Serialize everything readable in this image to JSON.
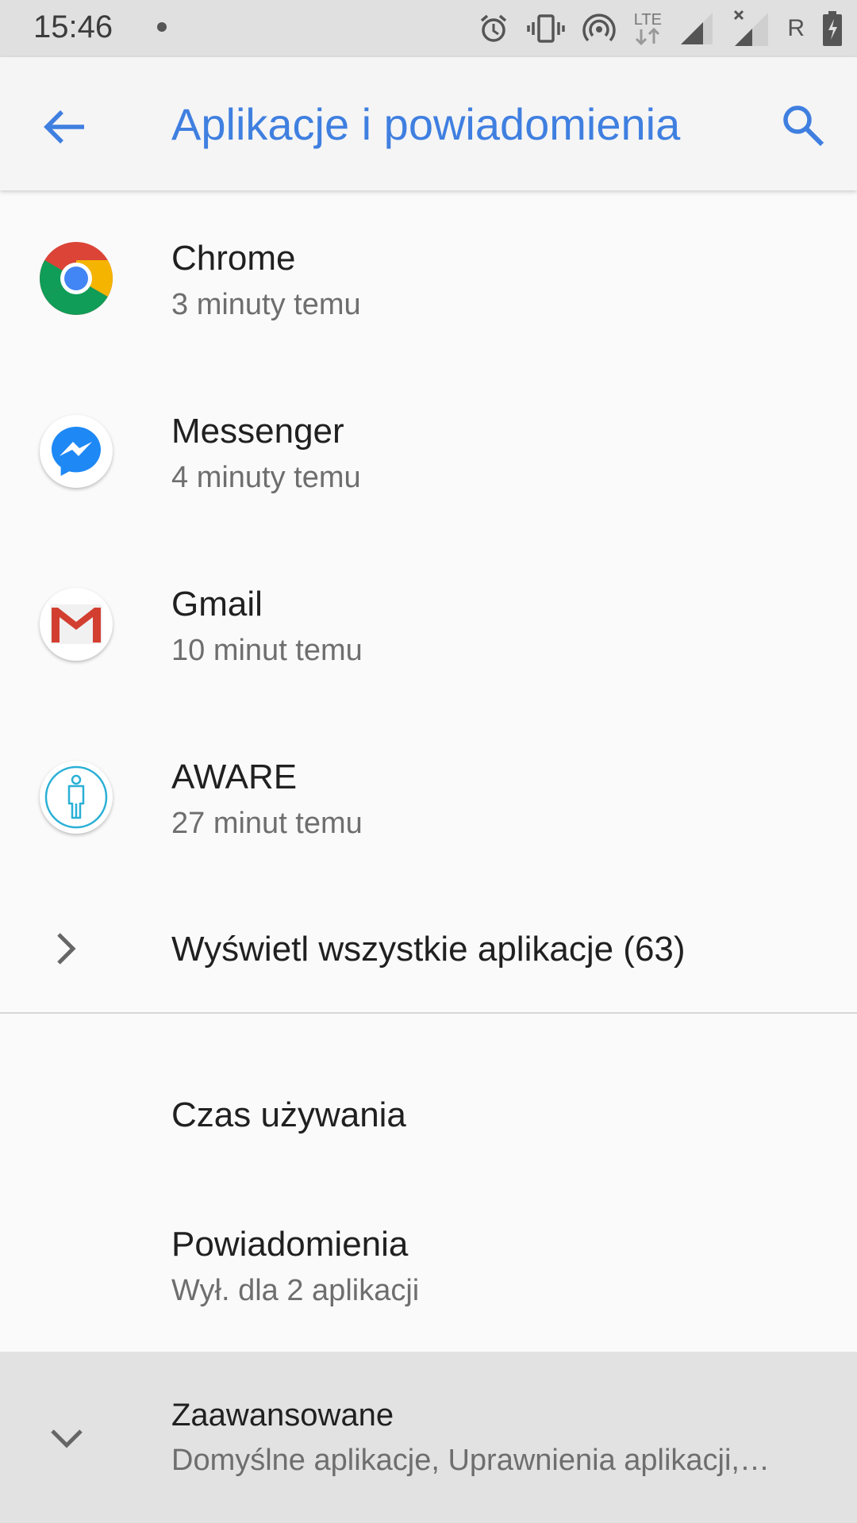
{
  "status_bar": {
    "time": "15:46",
    "network_label": "LTE",
    "roaming_label": "R",
    "icons": [
      "alarm-icon",
      "vibrate-icon",
      "hotspot-icon",
      "lte-data-icon",
      "signal-icon",
      "signal-no-service-icon",
      "battery-charging-icon"
    ]
  },
  "app_bar": {
    "title": "Aplikacje i powiadomienia",
    "accent_color": "#3f7fe0"
  },
  "recent_apps": [
    {
      "name": "Chrome",
      "time": "3 minuty temu",
      "icon": "chrome-icon"
    },
    {
      "name": "Messenger",
      "time": "4 minuty temu",
      "icon": "messenger-icon"
    },
    {
      "name": "Gmail",
      "time": "10 minut temu",
      "icon": "gmail-icon"
    },
    {
      "name": "AWARE",
      "time": "27 minut temu",
      "icon": "aware-icon"
    }
  ],
  "see_all": {
    "label": "Wyświetl wszystkie aplikacje (63)"
  },
  "settings": {
    "screen_time": {
      "title": "Czas używania"
    },
    "notifications": {
      "title": "Powiadomienia",
      "summary": "Wył. dla 2 aplikacji"
    },
    "advanced": {
      "title": "Zaawansowane",
      "summary": "Domyślne aplikacje, Uprawnienia aplikacji,…"
    }
  }
}
